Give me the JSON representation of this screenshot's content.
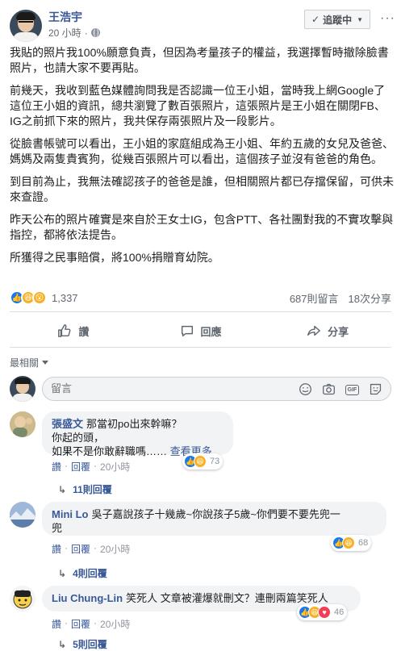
{
  "post": {
    "author": "王浩宇",
    "time": "20 小時",
    "time_sep": "·",
    "follow_label": "追蹤中",
    "more_label": "···",
    "paragraphs": [
      "我貼的照片我100%願意負責，但因為考量孩子的權益，我選擇暫時撤除臉書照片，也請大家不要再貼。",
      "前幾天，我收到藍色媒體詢問我是否認識一位王小姐，當時我上網Google了這位王小姐的資訊，總共瀏覽了數百張照片，這張照片是王小姐在關閉FB、IG之前抓下來的照片，我共保存兩張照片及一段影片。",
      "從臉書帳號可以看出，王小姐的家庭組成為王小姐、年約五歲的女兒及爸爸、媽媽及兩隻貴賓狗，從幾百張照片可以看出，這個孩子並沒有爸爸的角色。",
      "到目前為止，我無法確認孩子的爸爸是誰，但相關照片都已存擋保留，可供未來查證。",
      "昨天公布的照片確實是來自於王女士IG，包含PTT、各社團對我的不實攻擊與指控，都將依法提告。",
      "所獲得之民事賠償，將100%捐贈育幼院。"
    ],
    "reaction_count": "1,337",
    "comments_count": "687則留言",
    "shares_count": "18次分享"
  },
  "actions": {
    "like": "讚",
    "comment": "回應",
    "share": "分享"
  },
  "sort_label": "最相關",
  "compose": {
    "placeholder": "留言"
  },
  "comments": [
    {
      "name": "張盛文",
      "text_line1": "那當初po出來幹嘛？",
      "text_line2": "你起的頭，",
      "text_line3": "如果不是你敢辭職嗎……",
      "see_more": "查看更多",
      "reactions": "73",
      "like": "讚",
      "reply": "回覆",
      "time": "20小時",
      "replies": "11則回覆"
    },
    {
      "name": "Mini Lo",
      "text_line1": "吳子嘉說孩子十幾歲~你說孩子5歲~你們要不要先兜一",
      "text_line2": "兜",
      "reactions": "68",
      "like": "讚",
      "reply": "回覆",
      "time": "20小時",
      "replies": "4則回覆"
    },
    {
      "name": "Liu Chung-Lin",
      "text_line1": "笑死人 文章被灌爆就刪文？連刪兩篇笑死人",
      "reactions": "46",
      "like": "讚",
      "reply": "回覆",
      "time": "20小時",
      "replies": "5則回覆"
    }
  ],
  "sep": "·"
}
